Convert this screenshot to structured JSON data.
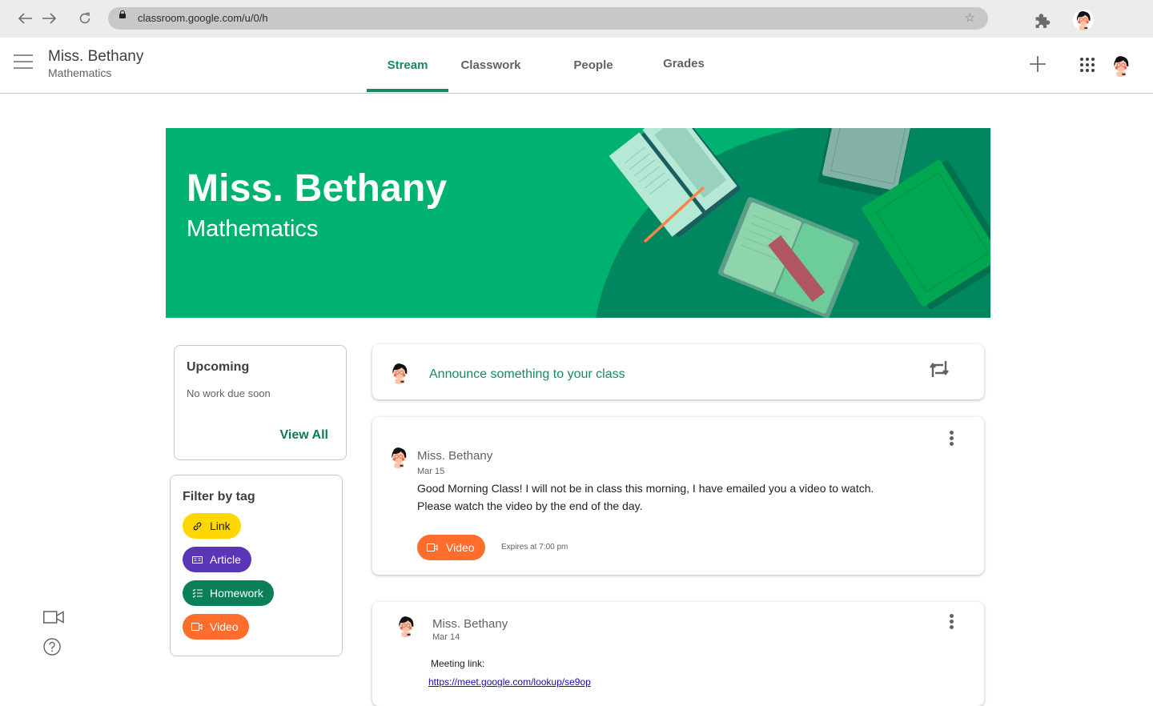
{
  "browser": {
    "url": "classroom.google.com/u/0/h",
    "back_icon": "arrow-left-icon",
    "forward_icon": "arrow-right-icon",
    "reload_icon": "reload-icon"
  },
  "header": {
    "course_title": "Miss. Bethany",
    "course_subtitle": "Mathematics",
    "tabs": [
      {
        "label": "Stream",
        "active": true
      },
      {
        "label": "Classwork",
        "active": false
      },
      {
        "label": "People",
        "active": false
      },
      {
        "label": "Grades",
        "active": false
      }
    ]
  },
  "banner": {
    "title": "Miss. Bethany",
    "subtitle": "Mathematics"
  },
  "upcoming": {
    "heading": "Upcoming",
    "message": "No work due soon",
    "view_all": "View All"
  },
  "filter": {
    "heading": "Filter by tag",
    "tags": [
      {
        "label": "Link",
        "color": "#ffd800",
        "text_color": "#202124",
        "icon": "link-icon"
      },
      {
        "label": "Article",
        "color": "#5a35b5",
        "text_color": "#ffffff",
        "icon": "article-icon"
      },
      {
        "label": "Homework",
        "color": "#0b7f5a",
        "text_color": "#ffffff",
        "icon": "checklist-icon"
      },
      {
        "label": "Video",
        "color": "#ff6d2d",
        "text_color": "#ffffff",
        "icon": "video-icon"
      }
    ]
  },
  "announce": {
    "placeholder": "Announce something to your class"
  },
  "posts": [
    {
      "author": "Miss. Bethany",
      "date": "Mar 15",
      "body_line1": "Good Morning Class! I will not be in class this morning, I have emailed you a video to watch.",
      "body_line2": "Please watch the video by the end of the day.",
      "tag_label": "Video",
      "expires": "Expires at 7:00 pm"
    },
    {
      "author": "Miss. Bethany",
      "date": "Mar 14",
      "body_label": "Meeting link:",
      "link": "https://meet.google.com/lookup/se9op"
    }
  ],
  "colors": {
    "accent": "#188a5f",
    "banner": "#00b26f",
    "banner_dark": "#00875f"
  }
}
